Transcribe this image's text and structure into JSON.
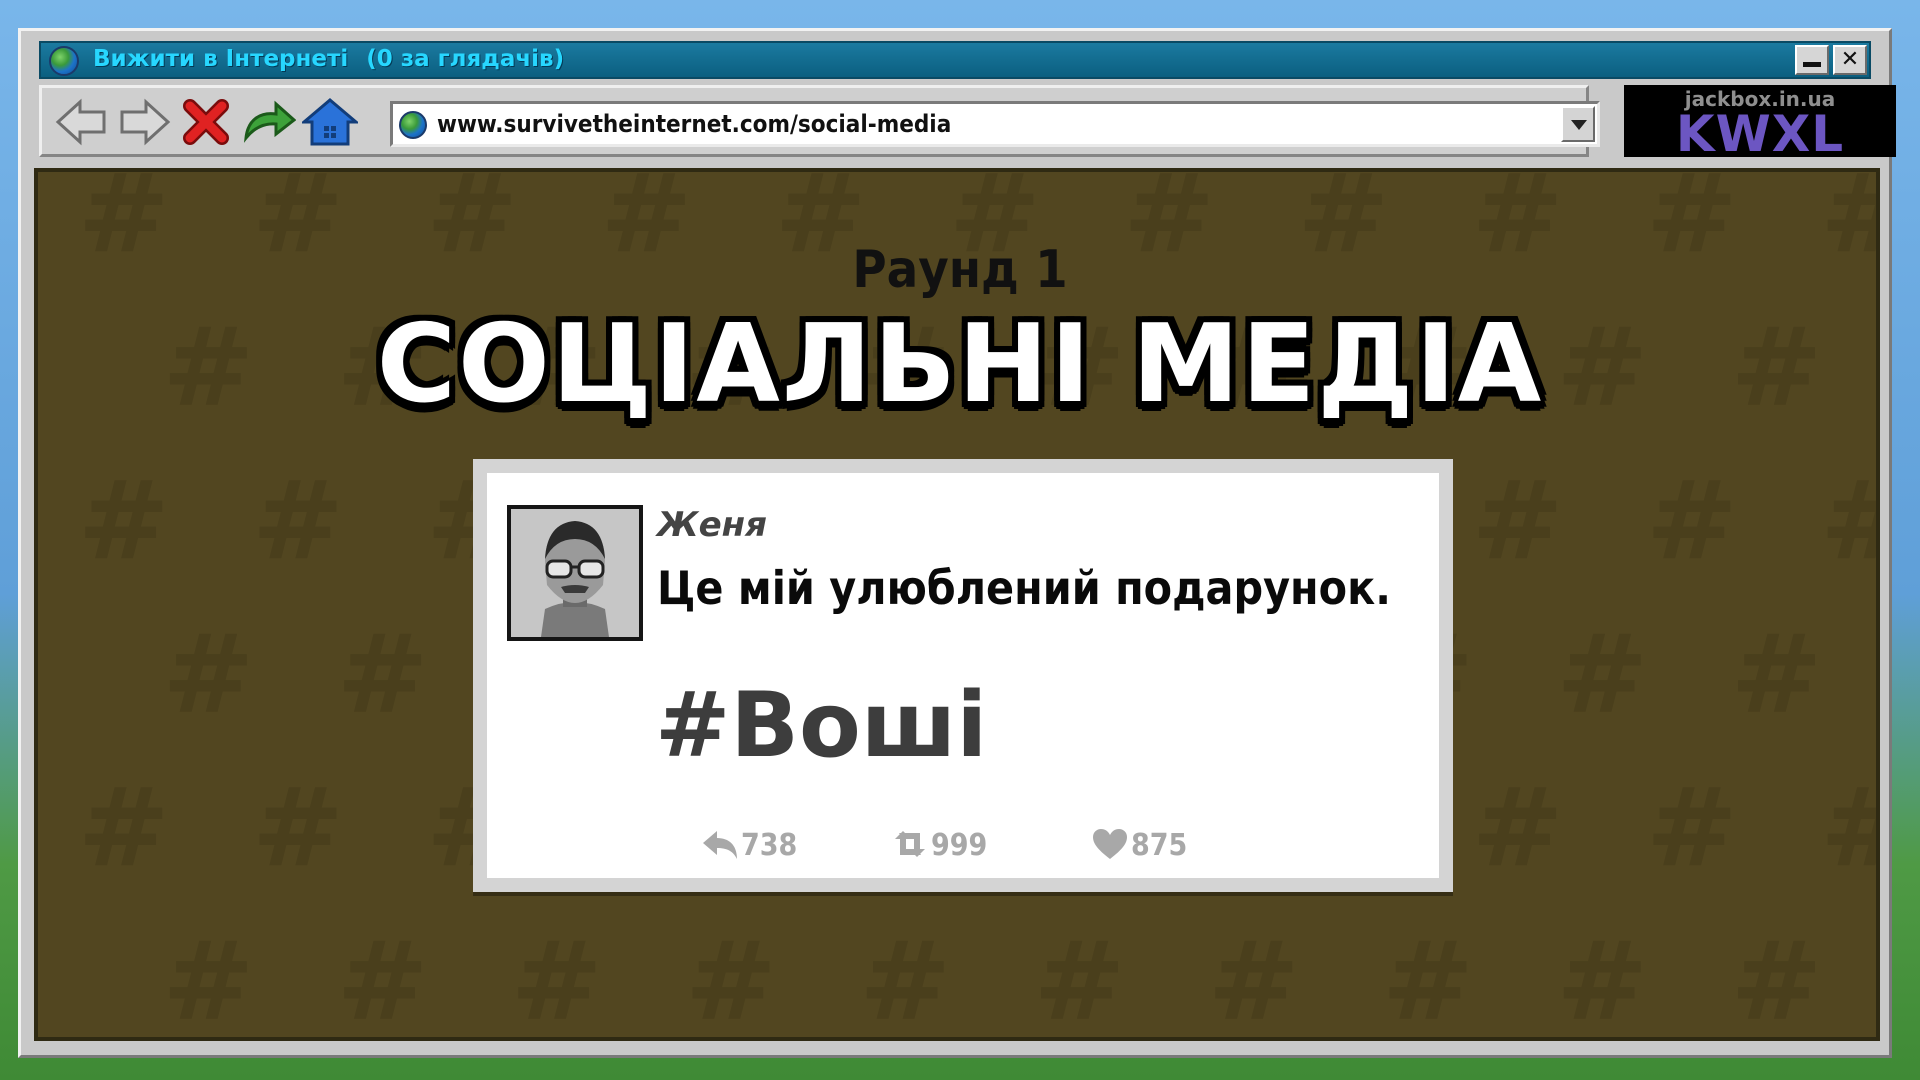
{
  "window": {
    "title": "Вижити в Інтернеті",
    "viewers": "(0 за глядачів)",
    "minimize_label": "",
    "close_label": "✕"
  },
  "toolbar": {
    "icons": [
      "back-arrow-icon",
      "forward-arrow-icon",
      "stop-x-icon",
      "refresh-arrow-icon",
      "home-icon"
    ],
    "url": "www.survivetheinternet.com/social-media"
  },
  "branding": {
    "site": "jackbox.in.ua",
    "logo": "KWXL"
  },
  "screen": {
    "round_label": "Раунд 1",
    "title": "СОЦІАЛЬНІ МЕДІА"
  },
  "post": {
    "username": "Женя",
    "text": "Це мій улюблений подарунок.",
    "hashtag": "#Boші",
    "replies": "738",
    "retweets": "999",
    "likes": "875"
  },
  "colors": {
    "titlebar": "#0b5f80",
    "title_text": "#27d7ff",
    "content_bg": "#564a22",
    "logo_text": "#6c56c2"
  }
}
